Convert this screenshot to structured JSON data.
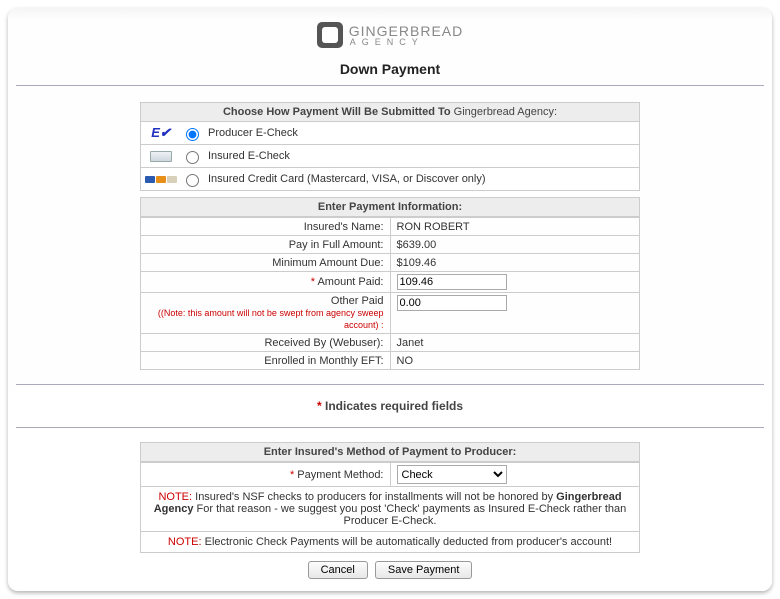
{
  "brand": {
    "line1": "GINGERBREAD",
    "line2": "AGENCY"
  },
  "page_title": "Down Payment",
  "submit_section": {
    "heading_prefix": "Choose How Payment Will Be Submitted To ",
    "heading_agency": "Gingerbread Agency",
    "heading_suffix": ":",
    "options": {
      "producer_echeck": "Producer E-Check",
      "insured_echeck": "Insured E-Check",
      "insured_cc": "Insured Credit Card (Mastercard, VISA, or Discover only)"
    },
    "selected": "producer_echeck"
  },
  "payment_info": {
    "heading": "Enter Payment Information:",
    "insured_name_label": "Insured's Name:",
    "insured_name_value": "RON  ROBERT",
    "pay_full_label": "Pay in Full Amount:",
    "pay_full_value": "$639.00",
    "min_due_label": "Minimum Amount Due:",
    "min_due_value": "$109.46",
    "amount_paid_label": "Amount Paid:",
    "amount_paid_value": "109.46",
    "other_paid_label": "Other Paid",
    "other_paid_value": "0.00",
    "other_note_prefix": "(Note:",
    "other_note_rest": " this amount will not be swept from agency sweep account) :",
    "received_by_label": "Received By (Webuser):",
    "received_by_value": "Janet",
    "enrolled_label": "Enrolled in Monthly EFT:",
    "enrolled_value": "NO"
  },
  "required_legend_prefix": "* ",
  "required_legend": "Indicates required fields",
  "method_section": {
    "heading": "Enter Insured's Method of Payment to Producer:",
    "payment_method_label": "Payment Method:",
    "payment_method_value": "Check",
    "note1_lead": "NOTE:",
    "note1_body_a": "  Insured's NSF checks to producers for installments will not be honored by ",
    "note1_agency": "Gingerbread Agency",
    "note1_body_b": " For that reason - we suggest you post 'Check' payments as Insured E-Check rather than Producer E-Check.",
    "note2_lead": "NOTE:",
    "note2_body": " Electronic Check Payments will be automatically deducted from producer's account!"
  },
  "buttons": {
    "cancel": "Cancel",
    "save": "Save Payment"
  }
}
